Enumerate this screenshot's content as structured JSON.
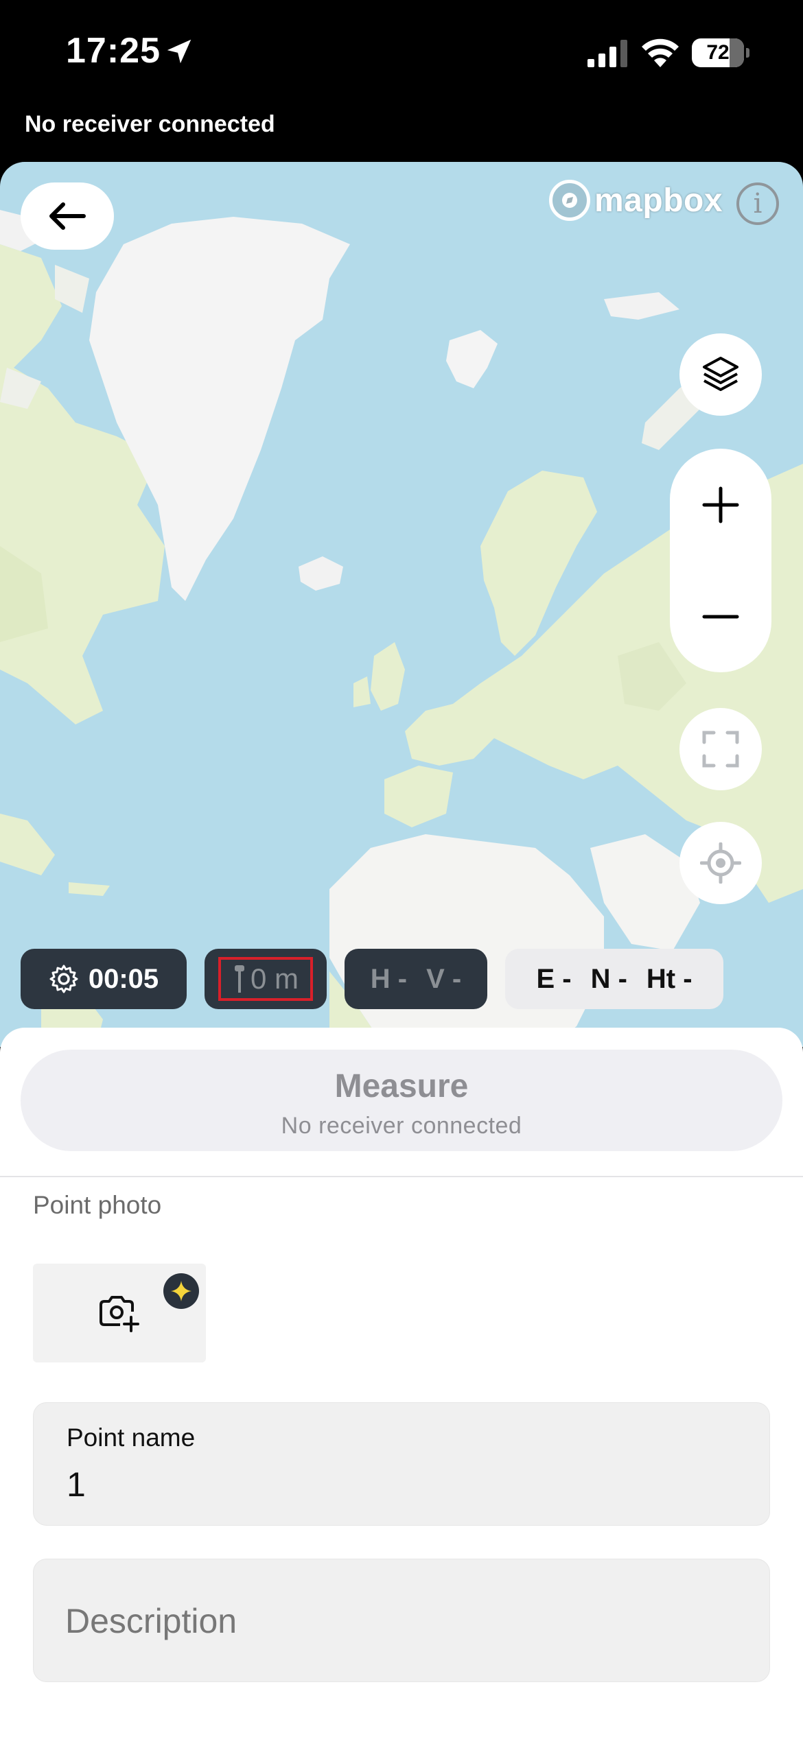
{
  "status_bar": {
    "time": "17:25",
    "battery_level": "72",
    "battery_percent": 72
  },
  "banner": {
    "receiver_status": "No receiver connected"
  },
  "map": {
    "attribution_logo": "mapbox",
    "info_glyph": "i",
    "icons": [
      "back-arrow-icon",
      "mapbox-logo-icon",
      "info-icon",
      "layers-icon",
      "zoom-in-icon",
      "zoom-out-icon",
      "fullscreen-icon",
      "crosshair-locate-icon"
    ]
  },
  "chips": {
    "timer": "00:05",
    "pole_height": "0 m",
    "horizontal": "H -",
    "vertical": "V -",
    "easting": "E -",
    "northing": "N -",
    "height": "Ht -"
  },
  "measure": {
    "title": "Measure",
    "subtitle": "No receiver connected"
  },
  "photo": {
    "label": "Point photo"
  },
  "point_name": {
    "label": "Point name",
    "value": "1"
  },
  "description": {
    "placeholder": "Description"
  },
  "colors": {
    "ocean": "#b4dbea",
    "land_light": "#e8f1d3",
    "ice": "#f4f4f4",
    "chip_dark": "#2d3640",
    "highlight": "#d8202a",
    "badge_star": "#f5d43b"
  }
}
